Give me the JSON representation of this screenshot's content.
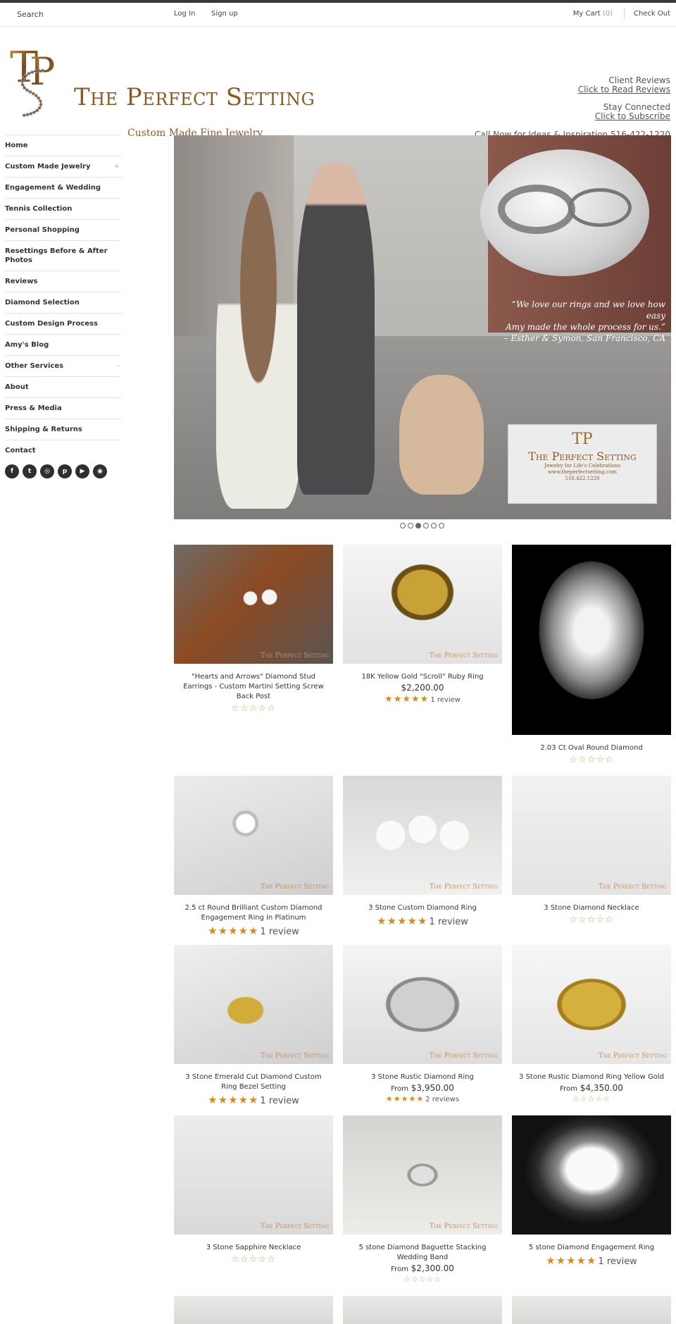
{
  "topbar": {
    "search_placeholder": "Search",
    "login": "Log In",
    "signup": "Sign up",
    "cart_label": "My Cart",
    "cart_count": "(0)",
    "checkout": "Check Out"
  },
  "header": {
    "brand": "The Perfect Setting",
    "tagline": "Custom Made Fine Jewelry",
    "reviews_title": "Client Reviews",
    "reviews_link": "Click to Read Reviews",
    "connected_title": "Stay Connected",
    "subscribe_link": "Click to Subscribe",
    "phone_line": "Call Now for Ideas & Inspiration 516-422-1220"
  },
  "sidebar": {
    "items": [
      {
        "label": "Home",
        "expand": ""
      },
      {
        "label": "Custom Made Jewelry",
        "expand": "+"
      },
      {
        "label": "Engagement & Wedding",
        "expand": ""
      },
      {
        "label": "Tennis Collection",
        "expand": ""
      },
      {
        "label": "Personal Shopping",
        "expand": ""
      },
      {
        "label": "Resettings Before & After Photos",
        "expand": ""
      },
      {
        "label": "Reviews",
        "expand": ""
      },
      {
        "label": "Diamond Selection",
        "expand": ""
      },
      {
        "label": "Custom Design Process",
        "expand": ""
      },
      {
        "label": "Amy's Blog",
        "expand": ""
      },
      {
        "label": "Other Services",
        "expand": "-"
      },
      {
        "label": "About",
        "expand": ""
      },
      {
        "label": "Press & Media",
        "expand": ""
      },
      {
        "label": "Shipping & Returns",
        "expand": ""
      },
      {
        "label": "Contact",
        "expand": ""
      }
    ],
    "social": [
      "facebook-icon",
      "twitter-icon",
      "instagram-icon",
      "pinterest-icon",
      "youtube-icon",
      "rss-icon"
    ]
  },
  "hero": {
    "quote_line1": "“We love our rings and we love how easy",
    "quote_line2": "Amy made the whole process for us.”",
    "quote_author": "– Esther & Symon, San Francisco, CA",
    "card_brand": "The Perfect Setting",
    "card_tagline": "Jewelry for Life's Celebrations",
    "card_url": "www.theperfectsetting.com",
    "card_phone": "516.422.1220",
    "slides_total": 6,
    "slide_active": 3
  },
  "products": [
    {
      "title": "\"Hearts and Arrows\" Diamond Stud Earrings - Custom Martini Setting Screw Back Post",
      "price": "",
      "from": "",
      "stars": "☆☆☆☆☆",
      "reviews": ""
    },
    {
      "title": "18K Yellow Gold \"Scroll\" Ruby Ring",
      "price": "$2,200.00",
      "from": "",
      "stars": "★★★★★",
      "reviews": "1 review"
    },
    {
      "title": "2.03 Ct Oval Round Diamond",
      "price": "",
      "from": "",
      "stars": "☆☆☆☆☆",
      "reviews": ""
    },
    {
      "title": "2.5 ct Round Brilliant Custom Diamond Engagement Ring in Platinum",
      "price": "",
      "from": "",
      "stars": "★★★★★",
      "reviews": "1 review"
    },
    {
      "title": "3 Stone Custom Diamond Ring",
      "price": "",
      "from": "",
      "stars": "★★★★★",
      "reviews": "1 review"
    },
    {
      "title": "3 Stone Diamond Necklace",
      "price": "",
      "from": "",
      "stars": "☆☆☆☆☆",
      "reviews": ""
    },
    {
      "title": "3 Stone Emerald Cut Diamond Custom Ring Bezel Setting",
      "price": "",
      "from": "",
      "stars": "★★★★★",
      "reviews": "1 review"
    },
    {
      "title": "3 Stone Rustic Diamond Ring",
      "price": "$3,950.00",
      "from": "From",
      "stars": "★★★★★",
      "reviews": "2 reviews"
    },
    {
      "title": "3 Stone Rustic Diamond Ring Yellow Gold",
      "price": "$4,350.00",
      "from": "From",
      "stars": "☆☆☆☆☆",
      "reviews": ""
    },
    {
      "title": "3 Stone Sapphire Necklace",
      "price": "",
      "from": "",
      "stars": "☆☆☆☆☆",
      "reviews": ""
    },
    {
      "title": "5 stone Diamond Baguette Stacking Wedding Band",
      "price": "$2,300.00",
      "from": "From",
      "stars": "☆☆☆☆☆",
      "reviews": ""
    },
    {
      "title": "5 stone Diamond Engagement Ring",
      "price": "",
      "from": "",
      "stars": "★★★★★",
      "reviews": "1 review"
    }
  ],
  "watermark": "The Perfect Setting",
  "colors": {
    "brand_bronze": "#8a5a25",
    "star_orange": "#d98a1c",
    "topbar_dark": "#3a3a3a"
  }
}
